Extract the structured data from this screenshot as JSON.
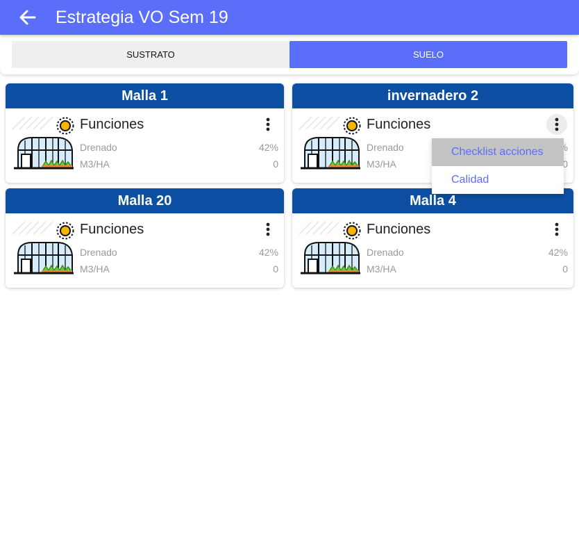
{
  "appbar": {
    "title": "Estrategia VO Sem 19",
    "back_icon": "arrow-left-icon"
  },
  "tabs": [
    {
      "label": "SUSTRATO",
      "selected": false
    },
    {
      "label": "SUELO",
      "selected": true
    }
  ],
  "colors": {
    "primary": "#5b6ef9",
    "card_header": "#0d4fa3"
  },
  "cards": [
    {
      "title": "Malla 1",
      "function_label": "Funciones",
      "drenado_label": "Drenado",
      "drenado_value": "42%",
      "m3ha_label": "M3/HA",
      "m3ha_value": "0"
    },
    {
      "title": "invernadero 2",
      "function_label": "Funciones",
      "drenado_label": "Drenado",
      "drenado_value": "42%",
      "m3ha_label": "M3/HA",
      "m3ha_value": "0"
    },
    {
      "title": "Malla 20",
      "function_label": "Funciones",
      "drenado_label": "Drenado",
      "drenado_value": "42%",
      "m3ha_label": "M3/HA",
      "m3ha_value": "0"
    },
    {
      "title": "Malla 4",
      "function_label": "Funciones",
      "drenado_label": "Drenado",
      "drenado_value": "42%",
      "m3ha_label": "M3/HA",
      "m3ha_value": "0"
    }
  ],
  "context_menu": {
    "items": [
      {
        "label": "Checklist acciones",
        "highlighted": true
      },
      {
        "label": "Calidad",
        "highlighted": false
      }
    ]
  }
}
